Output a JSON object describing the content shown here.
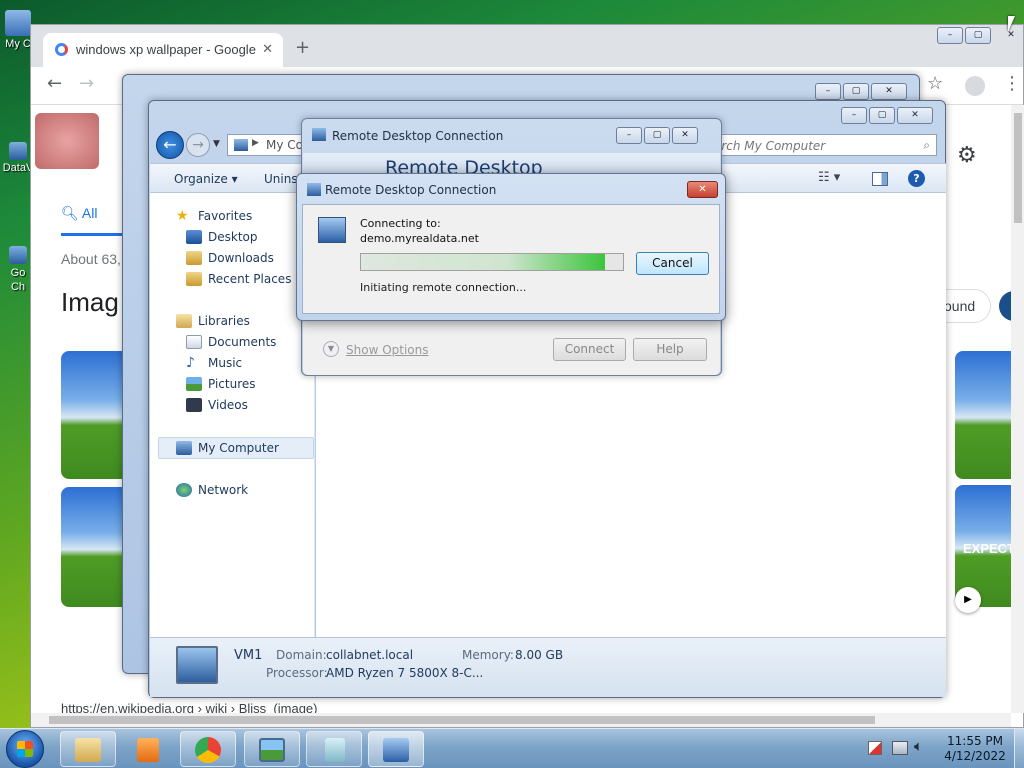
{
  "desktop": {
    "icons": [
      {
        "name": "my-computer",
        "label": "My C"
      },
      {
        "name": "datav",
        "label": "DataV"
      },
      {
        "name": "google-chrome",
        "label": "Go\nCh"
      }
    ]
  },
  "chrome": {
    "tab_title": "windows xp wallpaper - Google",
    "new_tab": "+",
    "google_tabs": {
      "all": "All"
    },
    "result_count": "About 63,",
    "images_heading": "Imag",
    "chip_text": "ound",
    "expect_text": "EXPECT",
    "source_url": "https://en.wikipedia.org › wiki › Bliss_(image)"
  },
  "explorer": {
    "address_text": "My Co",
    "search_placeholder": "arch My Computer",
    "organize": "Organize ▾",
    "uninstall": "Unins",
    "nav": {
      "favorites": "Favorites",
      "desktop": "Desktop",
      "downloads": "Downloads",
      "recent_places": "Recent Places",
      "libraries": "Libraries",
      "documents": "Documents",
      "music": "Music",
      "pictures": "Pictures",
      "videos": "Videos",
      "my_computer": "My Computer",
      "network": "Network"
    },
    "details": {
      "name": "VM1",
      "domain_label": "Domain:",
      "domain_value": "collabnet.local",
      "memory_label": "Memory:",
      "memory_value": "8.00 GB",
      "processor_label": "Processor:",
      "processor_value": "AMD Ryzen 7 5800X 8-C..."
    }
  },
  "rdc_main": {
    "title": "Remote Desktop Connection",
    "banner": "Remote Desktop",
    "show_options": "Show Options",
    "connect": "Connect",
    "help": "Help"
  },
  "rdc_connecting": {
    "title": "Remote Desktop Connection",
    "connecting_to": "Connecting to:",
    "host": "demo.myrealdata.net",
    "status": "Initiating remote connection...",
    "cancel": "Cancel",
    "progress_fraction": 0.93
  },
  "taskbar": {
    "time": "11:55 PM",
    "date": "4/12/2022"
  },
  "colors": {
    "accent": "#1a73e8",
    "progress_green": "#3cc43c",
    "close_red": "#c8402f"
  }
}
